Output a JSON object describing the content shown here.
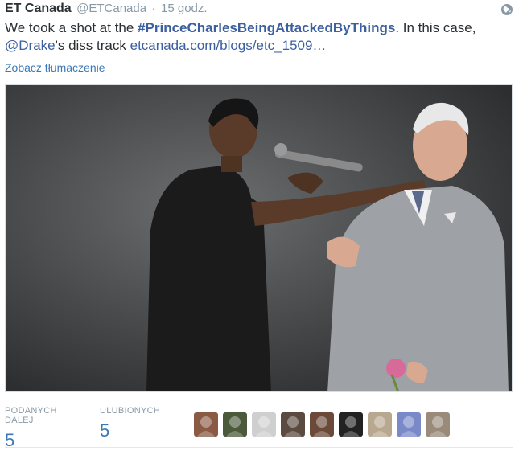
{
  "tweet": {
    "author_name": "ET Canada",
    "author_handle": "@ETCanada",
    "separator": "·",
    "time": "15 godz.",
    "text_before_hashtag": "We took a shot at the ",
    "hashtag": "#PrinceCharlesBeingAttackedByThings",
    "text_after_hashtag": ". In this case,",
    "mention": "@Drake",
    "text_after_mention": "'s diss track ",
    "link": "etcanada.com/blogs/etc_1509…",
    "translate_label": "Zobacz tłumaczenie"
  },
  "stats": {
    "retweets_label": "PODANYCH DALEJ",
    "retweets_count": "5",
    "favorites_label": "ULUBIONYCH",
    "favorites_count": "5"
  },
  "icons": {
    "globe": "globe-icon"
  },
  "colors": {
    "link": "#3b78b7",
    "hashtag": "#3b5fa0",
    "muted": "#8899a6",
    "text": "#292f33"
  },
  "avatars": [
    {
      "name": "favoriter-avatar-1",
      "color": "#8a5a44"
    },
    {
      "name": "favoriter-avatar-2",
      "color": "#4a5a3a"
    },
    {
      "name": "favoriter-avatar-3",
      "color": "#cfcfcf"
    },
    {
      "name": "favoriter-avatar-4",
      "color": "#5a4a40"
    },
    {
      "name": "favoriter-avatar-5",
      "color": "#6b4a3a"
    },
    {
      "name": "favoriter-avatar-6",
      "color": "#222222"
    },
    {
      "name": "favoriter-avatar-7",
      "color": "#b8a890"
    },
    {
      "name": "favoriter-avatar-8",
      "color": "#7a8ac8"
    },
    {
      "name": "favoriter-avatar-9",
      "color": "#9a8a7a"
    }
  ]
}
